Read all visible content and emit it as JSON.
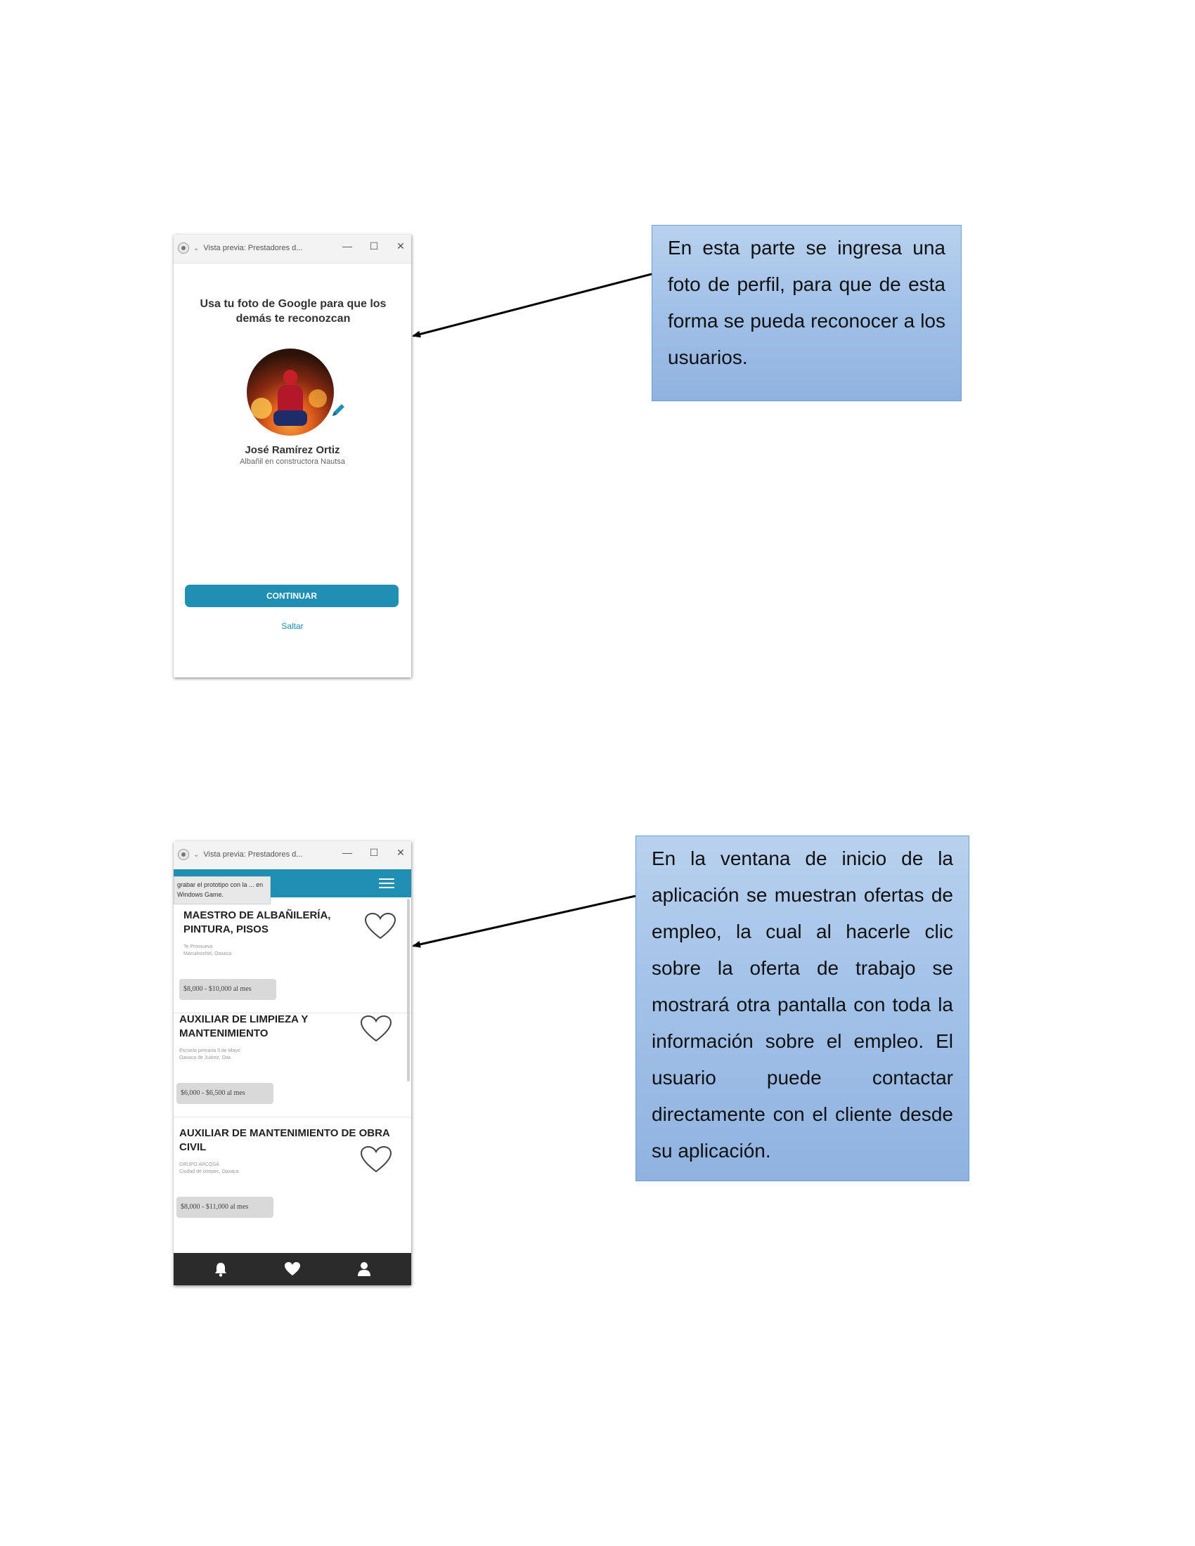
{
  "window": {
    "title": "Vista previa: Prestadores d...",
    "controls": [
      "—",
      "☐",
      "✕"
    ]
  },
  "screen1": {
    "heading": "Usa tu foto de Google para que los demás te reconozcan",
    "profile": {
      "name": "José Ramírez Ortiz",
      "role": "Albañil en constructora Nautsa"
    },
    "continue_label": "CONTINUAR",
    "skip_label": "Saltar",
    "accent": "#1f8fb3"
  },
  "screen2": {
    "toast": "grabar el prototipo con la ... en Windows Game.",
    "jobs": [
      {
        "title": "MAESTRO DE ALBAÑILERÍA, PINTURA, PISOS",
        "company": "Te Promuevo",
        "location": "Macuilxochitl, Oaxaca",
        "salary": "$8,000 - $10,000 al mes"
      },
      {
        "title": "AUXILIAR DE LIMPIEZA Y MANTENIMIENTO",
        "company": "Escuela primaria 5 de Mayo",
        "location": "Oaxaca de Juárez, Oax.",
        "salary": "$6,000 - $6,500 al mes"
      },
      {
        "title": "AUXILIAR DE MANTENIMIENTO DE OBRA CIVIL",
        "company": "GRUPO ARCOSA",
        "location": "Ciudad de Ixtepec, Oaxaca",
        "salary": "$8,000 - $11,000 al mes"
      }
    ],
    "nav_icons": [
      "bell-icon",
      "heart-icon",
      "user-icon"
    ],
    "header_color": "#1f8fb3",
    "nav_color": "#2b2b2b"
  },
  "callouts": [
    "En esta parte se ingresa una foto de perfil, para que de esta forma se pueda reconocer a los usuarios.",
    "En la ventana de inicio de la aplicación se muestran ofertas de empleo, la cual al hacerle clic sobre la oferta de trabajo se mostrará otra pantalla con toda la información sobre el empleo. El usuario puede contactar directamente con el cliente desde su aplicación."
  ]
}
